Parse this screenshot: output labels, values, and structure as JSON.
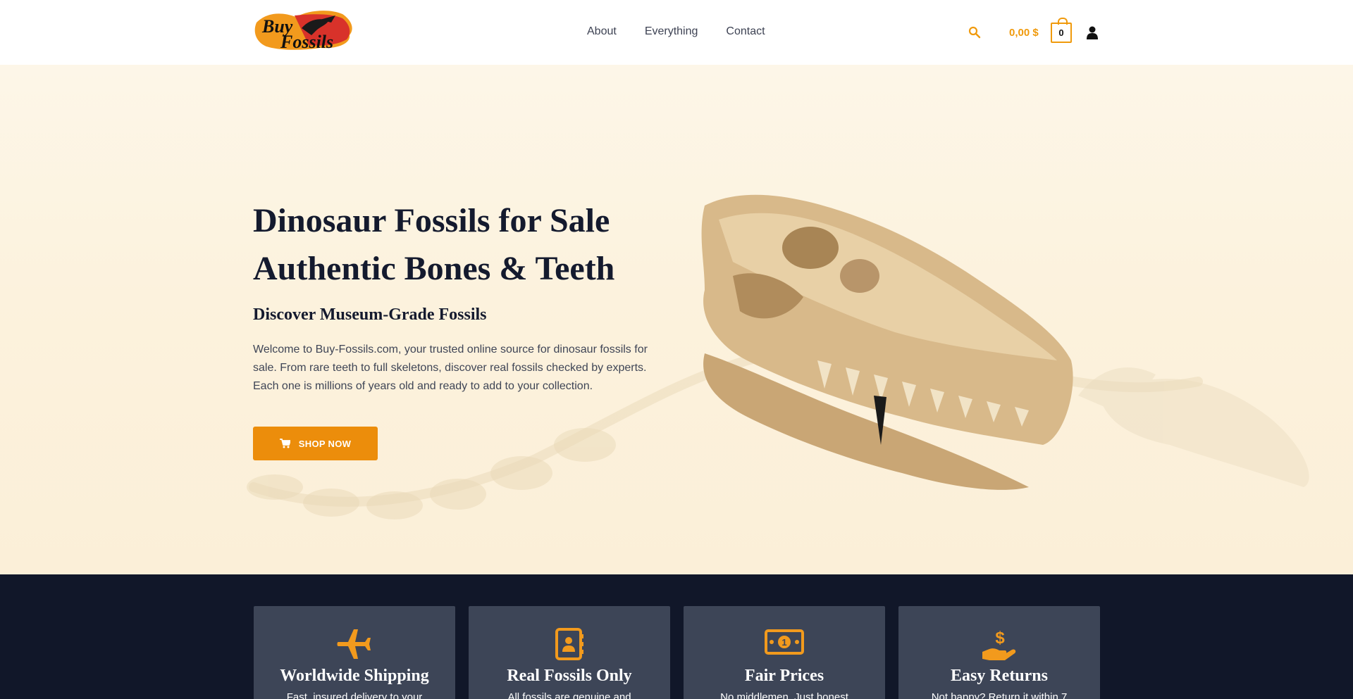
{
  "header": {
    "logo_text": "Buy Fossils",
    "nav": [
      "About",
      "Everything",
      "Contact"
    ],
    "cart_total": "0,00 $",
    "cart_count": "0"
  },
  "hero": {
    "title_line1": "Dinosaur Fossils for Sale",
    "title_line2": "Authentic Bones & Teeth",
    "subtitle": "Discover Museum-Grade Fossils",
    "text": "Welcome to Buy-Fossils.com, your trusted online source for dinosaur fossils for sale. From rare teeth to full skeletons, discover real fossils checked by experts. Each one is millions of years old and ready to add to your collection.",
    "button_label": "SHOP NOW"
  },
  "features": [
    {
      "icon": "airplane-icon",
      "title": "Worldwide Shipping",
      "text": "Fast, insured delivery to your"
    },
    {
      "icon": "certificate-icon",
      "title": "Real Fossils Only",
      "text": "All fossils are genuine and"
    },
    {
      "icon": "money-icon",
      "title": "Fair Prices",
      "text": "No middlemen. Just honest"
    },
    {
      "icon": "hand-dollar-icon",
      "title": "Easy Returns",
      "text": "Not happy? Return it within 7"
    }
  ],
  "colors": {
    "accent": "#ec8d0b",
    "dark": "#111729",
    "card": "#3d4557",
    "heading": "#141a2e"
  }
}
